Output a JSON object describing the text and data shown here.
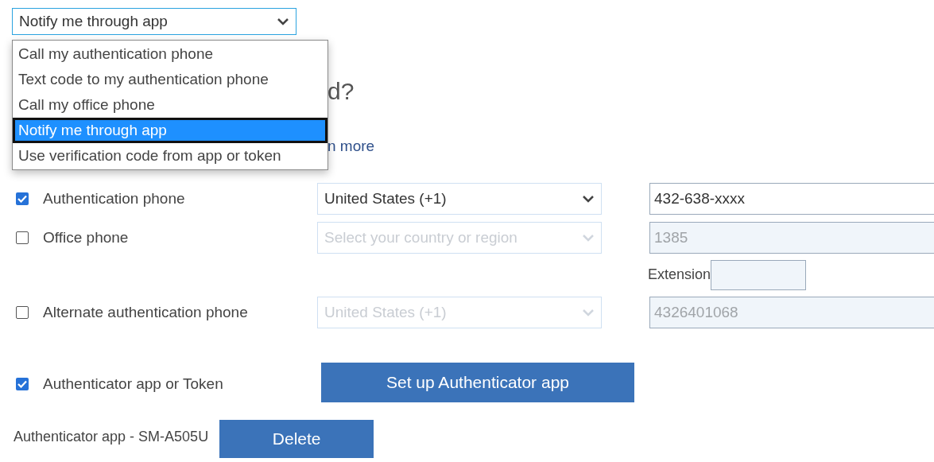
{
  "method_select": {
    "value": "Notify me through app",
    "expanded": true,
    "options": [
      {
        "label": "Call my authentication phone",
        "selected": false
      },
      {
        "label": "Text code to my authentication phone",
        "selected": false
      },
      {
        "label": "Call my office phone",
        "selected": false
      },
      {
        "label": "Notify me through app",
        "selected": true
      },
      {
        "label": "Use verification code from app or token",
        "selected": false
      }
    ]
  },
  "heading": "d?",
  "learn_more_link": "n more",
  "phone_rows": [
    {
      "label": "Authentication phone",
      "checked": true,
      "country": {
        "text": "United States (+1)",
        "disabled": false
      },
      "number": {
        "value": "432-638-xxxx",
        "disabled": false
      }
    },
    {
      "label": "Office phone",
      "checked": false,
      "country": {
        "text": "Select your country or region",
        "disabled": true
      },
      "number": {
        "value": "1385",
        "disabled": true
      },
      "extension": {
        "label": "Extension"
      }
    },
    {
      "label": "Alternate authentication phone",
      "checked": false,
      "country": {
        "text": "United States (+1)",
        "disabled": true
      },
      "number": {
        "value": "4326401068",
        "disabled": true
      }
    }
  ],
  "authenticator": {
    "label": "Authenticator app or Token",
    "checked": true,
    "button": "Set up Authenticator app"
  },
  "device": {
    "label": "Authenticator app - SM-A505U",
    "button": "Delete"
  }
}
